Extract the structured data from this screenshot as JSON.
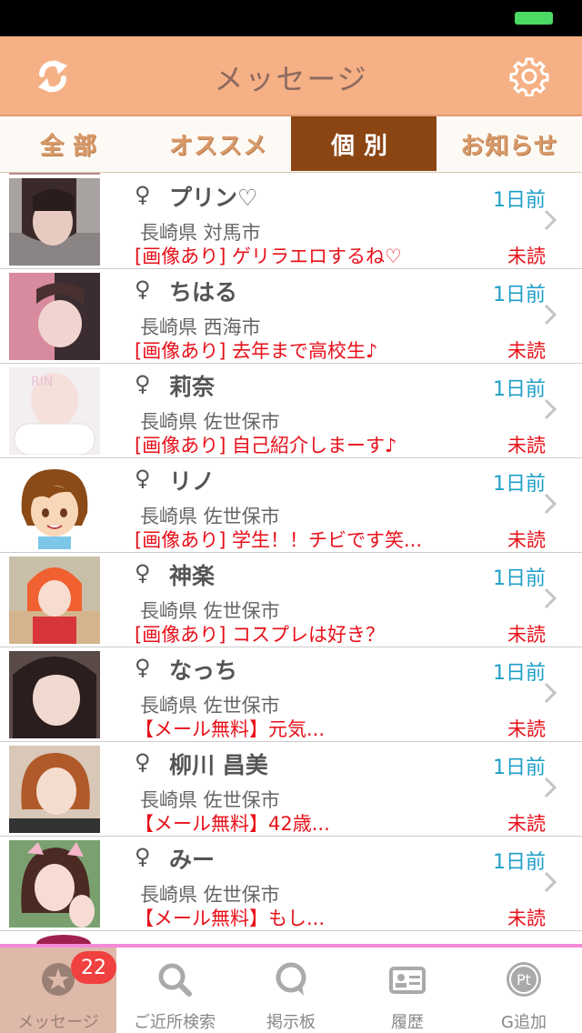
{
  "header": {
    "title": "メッセージ",
    "refresh_icon": "refresh-icon",
    "settings_icon": "gear-icon"
  },
  "tabs": [
    {
      "label": "全部",
      "active": false
    },
    {
      "label": "オススメ",
      "active": false
    },
    {
      "label": "個別",
      "active": true
    },
    {
      "label": "お知らせ",
      "active": false
    }
  ],
  "gender_symbol": "♀",
  "messages": [
    {
      "name": "プリン♡",
      "time": "1日前",
      "location": "長崎県 対馬市",
      "preview": "[画像あり] ゲリラエロするね♡",
      "status": "未読"
    },
    {
      "name": "ちはる",
      "time": "1日前",
      "location": "長崎県 西海市",
      "preview": "[画像あり] 去年まで高校生♪",
      "status": "未読"
    },
    {
      "name": "莉奈",
      "time": "1日前",
      "location": "長崎県 佐世保市",
      "preview": "[画像あり] 自己紹介しまーす♪",
      "status": "未読"
    },
    {
      "name": "リノ",
      "time": "1日前",
      "location": "長崎県 佐世保市",
      "preview": "[画像あり] 学生！！チビです笑...",
      "status": "未読"
    },
    {
      "name": "神楽",
      "time": "1日前",
      "location": "長崎県 佐世保市",
      "preview": "[画像あり] コスプレは好き？",
      "status": "未読"
    },
    {
      "name": "なっち",
      "time": "1日前",
      "location": "長崎県 佐世保市",
      "preview": "【メール無料】元気...",
      "status": "未読"
    },
    {
      "name": "柳川 昌美",
      "time": "1日前",
      "location": "長崎県 佐世保市",
      "preview": "【メール無料】42歳...",
      "status": "未読"
    },
    {
      "name": "みー",
      "time": "1日前",
      "location": "長崎県 佐世保市",
      "preview": "【メール無料】もし...",
      "status": "未読"
    }
  ],
  "bottom_nav": [
    {
      "label": "メッセージ",
      "icon": "star-circle-icon",
      "badge": "22",
      "active": true
    },
    {
      "label": "ご近所検索",
      "icon": "search-icon",
      "active": false
    },
    {
      "label": "掲示板",
      "icon": "speech-bubble-icon",
      "active": false
    },
    {
      "label": "履歴",
      "icon": "id-card-icon",
      "active": false
    },
    {
      "label": "G追加",
      "icon": "points-icon",
      "icon_text": "Pt",
      "active": false
    }
  ],
  "colors": {
    "header": "#f6b085",
    "tab_active": "#8b4513",
    "time": "#1e9fc8",
    "unread": "#e8101a",
    "badge": "#f04040"
  }
}
